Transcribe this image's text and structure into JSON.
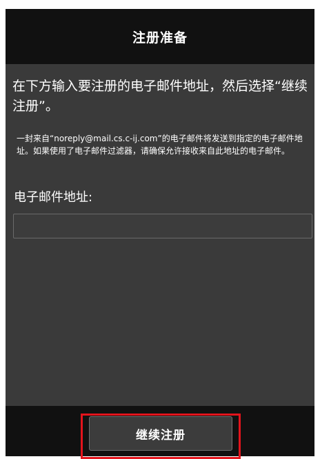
{
  "header": {
    "title": "注册准备"
  },
  "main": {
    "instruction": "在下方输入要注册的电子邮件地址，然后选择“继续注册”。",
    "note": "一封来自“noreply@mail.cs.c-ij.com”的电子邮件将发送到指定的电子邮件地址。如果使用了电子邮件过滤器，请确保允许接收来自此地址的电子邮件。",
    "email_label": "电子邮件地址:",
    "email_value": ""
  },
  "footer": {
    "continue_label": "继续注册",
    "highlight_color": "#e3141c"
  },
  "colors": {
    "header_bg": "#111111",
    "content_bg": "#3a3a3a",
    "text": "#ffffff"
  }
}
